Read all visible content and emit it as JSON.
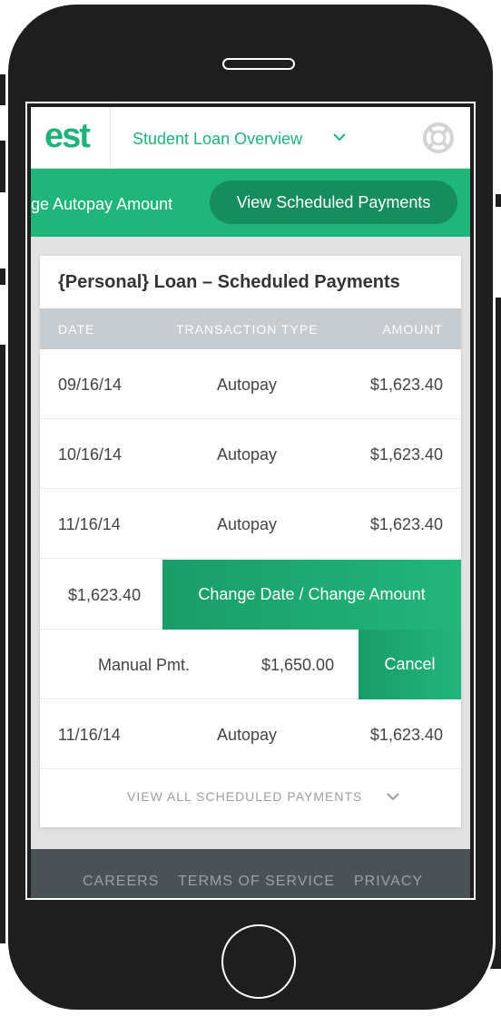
{
  "header": {
    "logo_text": "est",
    "nav_title": "Student Loan Overview",
    "brand_color": "#1fb37a",
    "icons": [
      "chevron-down-icon",
      "lifebuoy-icon"
    ]
  },
  "actions": {
    "partial_label": "ge Autopay Amount",
    "active_label": "View Scheduled Payments"
  },
  "card": {
    "title": "{Personal} Loan – Scheduled Payments",
    "columns": {
      "date": "DATE",
      "type": "TRANSACTION TYPE",
      "amount": "AMOUNT"
    },
    "rows": [
      {
        "date": "09/16/14",
        "type": "Autopay",
        "amount": "$1,623.40"
      },
      {
        "date": "10/16/14",
        "type": "Autopay",
        "amount": "$1,623.40"
      },
      {
        "date": "11/16/14",
        "type": "Autopay",
        "amount": "$1,623.40"
      }
    ],
    "swiped_row": {
      "amount": "$1,623.40",
      "action_label": "Change Date / Change Amount"
    },
    "manual_row": {
      "type": "Manual Pmt.",
      "amount": "$1,650.00",
      "action_label": "Cancel"
    },
    "last_row": {
      "date": "11/16/14",
      "type": "Autopay",
      "amount": "$1,623.40"
    },
    "view_all_label": "VIEW ALL SCHEDULED PAYMENTS"
  },
  "footer": {
    "links": [
      "CAREERS",
      "TERMS OF SERVICE",
      "PRIVACY"
    ]
  }
}
